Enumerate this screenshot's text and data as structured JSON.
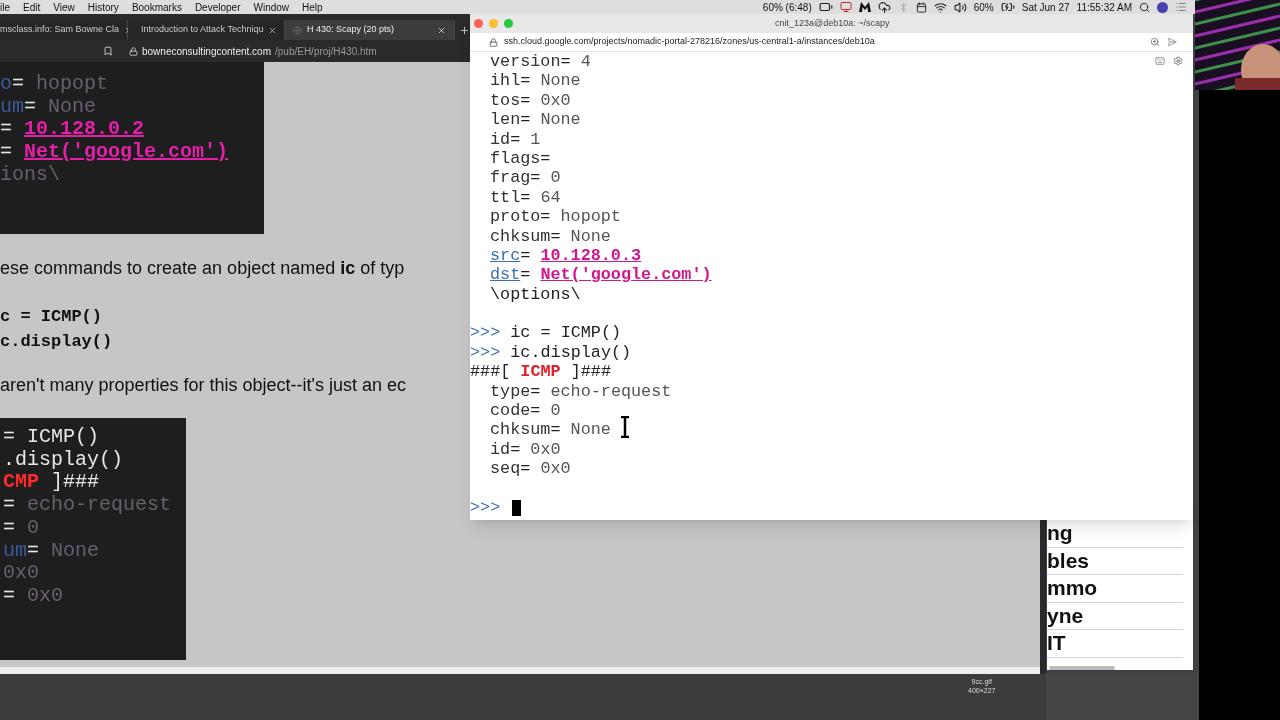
{
  "menu_bar": {
    "menus": [
      "ile",
      "Edit",
      "View",
      "History",
      "Bookmarks",
      "Developer",
      "Window",
      "Help"
    ],
    "status": {
      "battery_time": "60% (6:48)",
      "battery": "60%",
      "date": "Sat Jun 27",
      "time": "11:55:32 AM"
    }
  },
  "browser": {
    "tabs": [
      {
        "label": "msclass.info: Sam Bowne Cla",
        "selected": false
      },
      {
        "label": "Introduction to Attack Techniqu",
        "selected": false
      },
      {
        "label": "H 430: Scapy (20 pts)",
        "selected": true
      }
    ],
    "address": {
      "domain": "bowneconsultingcontent.com",
      "path": "/pub/EH/proj/H430.htm"
    },
    "code_image_1": [
      [
        {
          "t": "o",
          "kind": "key"
        },
        {
          "t": "= ",
          "kind": "plain"
        },
        {
          "t": "hopopt",
          "kind": "val"
        }
      ],
      [
        {
          "t": "um",
          "kind": "key"
        },
        {
          "t": "= ",
          "kind": "plain"
        },
        {
          "t": "None",
          "kind": "val"
        }
      ],
      [
        {
          "t": "= ",
          "kind": "plain"
        },
        {
          "t": "10.128.0.2",
          "kind": "link"
        }
      ],
      [
        {
          "t": "= ",
          "kind": "plain"
        },
        {
          "t": "Net('google.com')",
          "kind": "link"
        }
      ],
      [
        {
          "t": "ions\\",
          "kind": "val"
        }
      ]
    ],
    "paragraph_1": "ese commands to create an object named **ic** of typ",
    "code_block": [
      "c = ICMP()",
      "c.display()"
    ],
    "paragraph_2": "aren't many properties for this object--it's just an ec",
    "code_image_2": [
      [
        {
          "t": "= ICMP()",
          "kind": "plain"
        }
      ],
      [
        {
          "t": ".display()",
          "kind": "plain"
        }
      ],
      [
        {
          "t": "CMP",
          "kind": "red"
        },
        {
          "t": " ]###",
          "kind": "plain"
        }
      ],
      [
        {
          "t": "= ",
          "kind": "plain"
        },
        {
          "t": "echo-request",
          "kind": "val"
        }
      ],
      [
        {
          "t": "= ",
          "kind": "plain"
        },
        {
          "t": "0",
          "kind": "val"
        }
      ],
      [
        {
          "t": "um",
          "kind": "key"
        },
        {
          "t": "= ",
          "kind": "plain"
        },
        {
          "t": "None",
          "kind": "val"
        }
      ],
      [
        {
          "t": "0x0",
          "kind": "val"
        }
      ],
      [
        {
          "t": "= ",
          "kind": "plain"
        },
        {
          "t": "0x0",
          "kind": "val"
        }
      ]
    ],
    "image_caption": {
      "name": "9cc.gif",
      "size": "400×227"
    }
  },
  "back_window": {
    "rows": [
      "ng",
      "bles",
      "mmo",
      "yne",
      "IT"
    ]
  },
  "terminal": {
    "title": "cnit_123a@deb10a: ~/scapy",
    "url": "ssh.cloud.google.com/projects/nomadic-portal-278216/zones/us-central1-a/instances/deb10a",
    "lines": [
      {
        "kind": "field",
        "segs": [
          {
            "t": "version",
            "kind": "key"
          },
          {
            "t": "= ",
            "kind": "plain"
          },
          {
            "t": "4",
            "kind": "val"
          }
        ]
      },
      {
        "kind": "field",
        "segs": [
          {
            "t": "ihl",
            "kind": "key"
          },
          {
            "t": "= ",
            "kind": "plain"
          },
          {
            "t": "None",
            "kind": "val"
          }
        ]
      },
      {
        "kind": "field",
        "segs": [
          {
            "t": "tos",
            "kind": "key"
          },
          {
            "t": "= ",
            "kind": "plain"
          },
          {
            "t": "0x0",
            "kind": "val"
          }
        ]
      },
      {
        "kind": "field",
        "segs": [
          {
            "t": "len",
            "kind": "key"
          },
          {
            "t": "= ",
            "kind": "plain"
          },
          {
            "t": "None",
            "kind": "val"
          }
        ]
      },
      {
        "kind": "field",
        "segs": [
          {
            "t": "id",
            "kind": "key"
          },
          {
            "t": "= ",
            "kind": "plain"
          },
          {
            "t": "1",
            "kind": "val"
          }
        ]
      },
      {
        "kind": "field",
        "segs": [
          {
            "t": "flags",
            "kind": "key"
          },
          {
            "t": "=",
            "kind": "plain"
          }
        ]
      },
      {
        "kind": "field",
        "segs": [
          {
            "t": "frag",
            "kind": "key"
          },
          {
            "t": "= ",
            "kind": "plain"
          },
          {
            "t": "0",
            "kind": "val"
          }
        ]
      },
      {
        "kind": "field",
        "segs": [
          {
            "t": "ttl",
            "kind": "key"
          },
          {
            "t": "= ",
            "kind": "plain"
          },
          {
            "t": "64",
            "kind": "val"
          }
        ]
      },
      {
        "kind": "field",
        "segs": [
          {
            "t": "proto",
            "kind": "key"
          },
          {
            "t": "= ",
            "kind": "plain"
          },
          {
            "t": "hopopt",
            "kind": "val"
          }
        ]
      },
      {
        "kind": "field",
        "segs": [
          {
            "t": "chksum",
            "kind": "key"
          },
          {
            "t": "= ",
            "kind": "plain"
          },
          {
            "t": "None",
            "kind": "val"
          }
        ]
      },
      {
        "kind": "field",
        "segs": [
          {
            "t": "src",
            "kind": "linkkey"
          },
          {
            "t": "= ",
            "kind": "plain"
          },
          {
            "t": "10.128.0.3",
            "kind": "link"
          }
        ]
      },
      {
        "kind": "field",
        "segs": [
          {
            "t": "dst",
            "kind": "linkkey"
          },
          {
            "t": "= ",
            "kind": "plain"
          },
          {
            "t": "Net('google.com')",
            "kind": "link"
          }
        ]
      },
      {
        "kind": "field",
        "segs": [
          {
            "t": "\\options\\",
            "kind": "plain"
          }
        ]
      },
      {
        "kind": "blank"
      },
      {
        "kind": "top",
        "segs": [
          {
            "t": ">>> ",
            "kind": "prompt"
          },
          {
            "t": "ic = ICMP()",
            "kind": "plain"
          }
        ]
      },
      {
        "kind": "top",
        "segs": [
          {
            "t": ">>> ",
            "kind": "prompt"
          },
          {
            "t": "ic.display()",
            "kind": "plain"
          }
        ]
      },
      {
        "kind": "top",
        "segs": [
          {
            "t": "###[ ",
            "kind": "plain"
          },
          {
            "t": "ICMP",
            "kind": "red"
          },
          {
            "t": " ]###",
            "kind": "plain"
          }
        ]
      },
      {
        "kind": "field",
        "segs": [
          {
            "t": "type",
            "kind": "key"
          },
          {
            "t": "= ",
            "kind": "plain"
          },
          {
            "t": "echo-request",
            "kind": "val"
          }
        ]
      },
      {
        "kind": "field",
        "segs": [
          {
            "t": "code",
            "kind": "key"
          },
          {
            "t": "= ",
            "kind": "plain"
          },
          {
            "t": "0",
            "kind": "val"
          }
        ]
      },
      {
        "kind": "field",
        "segs": [
          {
            "t": "chksum",
            "kind": "key"
          },
          {
            "t": "= ",
            "kind": "plain"
          },
          {
            "t": "None",
            "kind": "val"
          }
        ]
      },
      {
        "kind": "field",
        "segs": [
          {
            "t": "id",
            "kind": "key"
          },
          {
            "t": "= ",
            "kind": "plain"
          },
          {
            "t": "0x0",
            "kind": "val"
          }
        ]
      },
      {
        "kind": "field",
        "segs": [
          {
            "t": "seq",
            "kind": "key"
          },
          {
            "t": "= ",
            "kind": "plain"
          },
          {
            "t": "0x0",
            "kind": "val"
          }
        ]
      },
      {
        "kind": "blank"
      },
      {
        "kind": "input",
        "segs": [
          {
            "t": ">>>",
            "kind": "prompt"
          }
        ]
      }
    ]
  }
}
